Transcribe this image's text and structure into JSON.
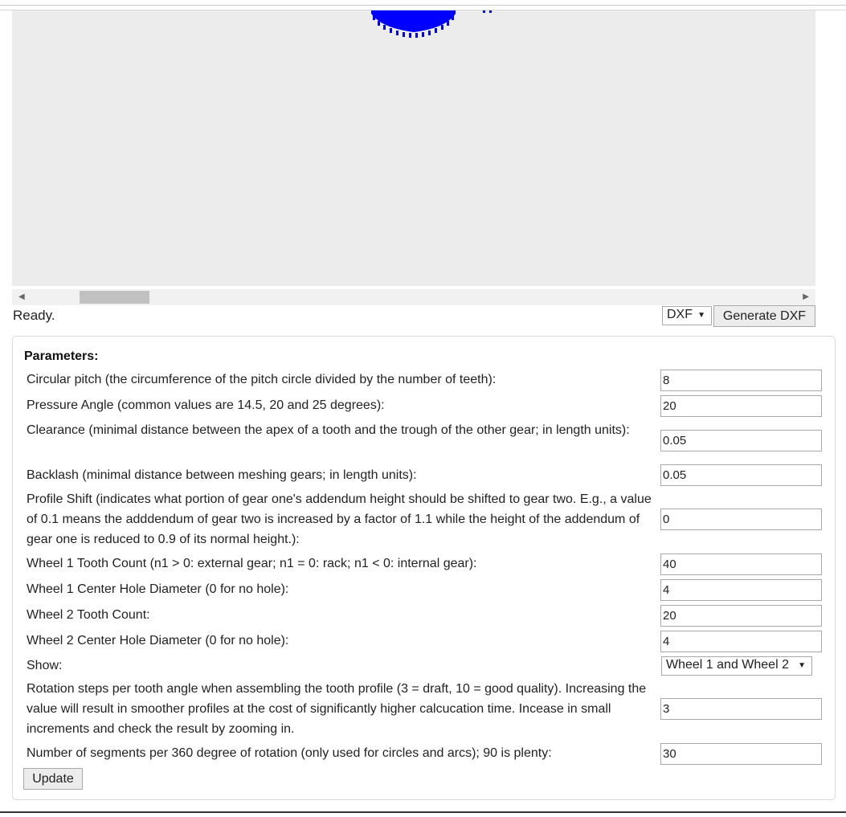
{
  "status": "Ready.",
  "export": {
    "format": "DXF",
    "generate_label": "Generate DXF"
  },
  "params": {
    "title": "Parameters:",
    "fields": [
      {
        "label": "Circular pitch (the circumference of the pitch circle divided by the number of teeth):",
        "value": "8"
      },
      {
        "label": "Pressure Angle (common values are 14.5, 20 and 25 degrees):",
        "value": "20"
      },
      {
        "label": "Clearance (minimal distance between the apex of a tooth and the trough of the other gear; in length units):",
        "value": "0.05"
      },
      {
        "label": "Backlash (minimal distance between meshing gears; in length units):",
        "value": "0.05"
      },
      {
        "label": "Profile Shift (indicates what portion of gear one's addendum height should be shifted to gear two. E.g., a value of 0.1 means the adddendum of gear two is increased by a factor of 1.1 while the height of the addendum of gear one is reduced to 0.9 of its normal height.):",
        "value": "0"
      },
      {
        "label": "Wheel 1 Tooth Count (n1 > 0: external gear; n1 = 0: rack; n1 < 0: internal gear):",
        "value": "40"
      },
      {
        "label": "Wheel 1 Center Hole Diameter (0 for no hole):",
        "value": "4"
      },
      {
        "label": "Wheel 2 Tooth Count:",
        "value": "20"
      },
      {
        "label": "Wheel 2 Center Hole Diameter (0 for no hole):",
        "value": "4"
      }
    ],
    "show": {
      "label": "Show:",
      "value": "Wheel 1 and Wheel 2"
    },
    "rotation_steps": {
      "label": "Rotation steps per tooth angle when assembling the tooth profile (3 = draft, 10 = good quality). Increasing the value will result in smoother profiles at the cost of significantly higher calcucation time. Incease in small increments and check the result by zooming in.",
      "value": "3"
    },
    "segments": {
      "label": "Number of segments per 360 degree of rotation (only used for circles and arcs); 90 is plenty:",
      "value": "30"
    },
    "update_label": "Update"
  },
  "colors": {
    "gear": "#0000ff",
    "viewer_bg": "#ececec"
  },
  "icons": {
    "caret": "caret-down-icon",
    "scroll_left": "scroll-left-icon",
    "scroll_right": "scroll-right-icon"
  }
}
